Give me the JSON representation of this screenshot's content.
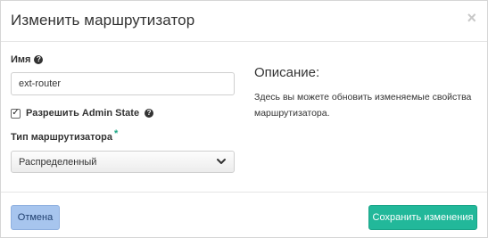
{
  "modal": {
    "title": "Изменить маршрутизатор",
    "close_symbol": "×"
  },
  "form": {
    "name_label": "Имя",
    "name_value": "ext-router",
    "admin_state_label": "Разрешить Admin State",
    "admin_state_checked": true,
    "check_symbol": "✓",
    "router_type_label": "Тип маршрутизатора",
    "required_mark": "*",
    "router_type_selected": "Распределенный",
    "help_symbol": "?"
  },
  "description": {
    "title": "Описание:",
    "text": "Здесь вы можете обновить изменяемые свойства маршрутизатора."
  },
  "footer": {
    "cancel_label": "Отмена",
    "save_label": "Сохранить изменения"
  },
  "colors": {
    "accent": "#22b89a",
    "cancel_button": "#a7c5ee",
    "required_mark": "#1ea886"
  },
  "icons": {
    "help": "question-circle-icon",
    "close": "close-icon",
    "dropdown": "chevron-down-icon",
    "checkbox": "checkbox-checked-icon"
  }
}
